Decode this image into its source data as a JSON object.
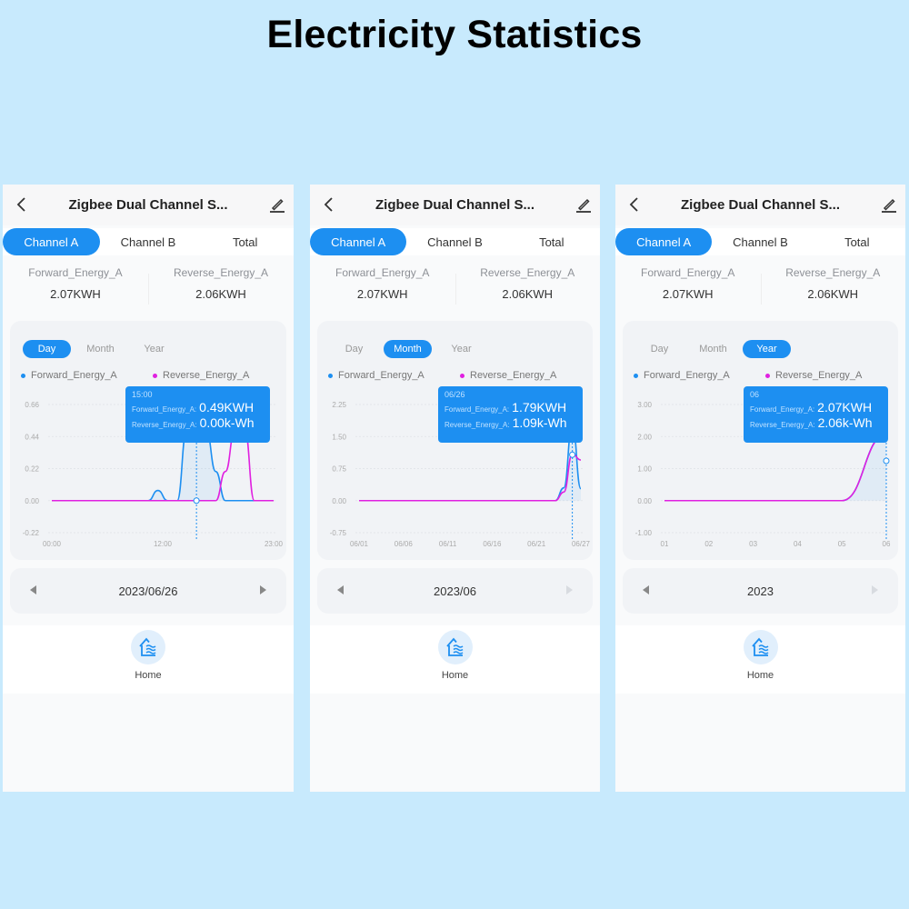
{
  "page_title": "Electricity Statistics",
  "colors": {
    "accent": "#1d8ff1",
    "forward": "#1d8ff1",
    "reverse": "#e020e0",
    "background": "#c8eafd"
  },
  "icons": {
    "back": "chevron-left-icon",
    "edit": "pencil-icon",
    "home": "home-waves-icon",
    "prev": "triangle-left-icon",
    "next": "triangle-right-icon"
  },
  "screens": [
    {
      "device_title": "Zigbee Dual Channel S...",
      "tabs": [
        {
          "label": "Channel A",
          "active": true
        },
        {
          "label": "Channel B",
          "active": false
        },
        {
          "label": "Total",
          "active": false
        }
      ],
      "energy": [
        {
          "label": "Forward_Energy_A",
          "value": "2.07KWH"
        },
        {
          "label": "Reverse_Energy_A",
          "value": "2.06KWH"
        }
      ],
      "ranges": [
        {
          "label": "Day",
          "active": true
        },
        {
          "label": "Month",
          "active": false
        },
        {
          "label": "Year",
          "active": false
        }
      ],
      "legend": [
        "Forward_Energy_A",
        "Reverse_Energy_A"
      ],
      "tooltip": {
        "time": "15:00",
        "forward_key": "Forward_Energy_A:",
        "forward_value": "0.49KWH",
        "reverse_key": "Reverse_Energy_A:",
        "reverse_value": "0.00k-Wh"
      },
      "date": "2023/06/26",
      "next_disabled": false,
      "nav_label": "Home"
    },
    {
      "device_title": "Zigbee Dual Channel S...",
      "tabs": [
        {
          "label": "Channel A",
          "active": true
        },
        {
          "label": "Channel B",
          "active": false
        },
        {
          "label": "Total",
          "active": false
        }
      ],
      "energy": [
        {
          "label": "Forward_Energy_A",
          "value": "2.07KWH"
        },
        {
          "label": "Reverse_Energy_A",
          "value": "2.06KWH"
        }
      ],
      "ranges": [
        {
          "label": "Day",
          "active": false
        },
        {
          "label": "Month",
          "active": true
        },
        {
          "label": "Year",
          "active": false
        }
      ],
      "legend": [
        "Forward_Energy_A",
        "Reverse_Energy_A"
      ],
      "tooltip": {
        "time": "06/26",
        "forward_key": "Forward_Energy_A:",
        "forward_value": "1.79KWH",
        "reverse_key": "Reverse_Energy_A:",
        "reverse_value": "1.09k-Wh"
      },
      "date": "2023/06",
      "next_disabled": true,
      "nav_label": "Home"
    },
    {
      "device_title": "Zigbee Dual Channel S...",
      "tabs": [
        {
          "label": "Channel A",
          "active": true
        },
        {
          "label": "Channel B",
          "active": false
        },
        {
          "label": "Total",
          "active": false
        }
      ],
      "energy": [
        {
          "label": "Forward_Energy_A",
          "value": "2.07KWH"
        },
        {
          "label": "Reverse_Energy_A",
          "value": "2.06KWH"
        }
      ],
      "ranges": [
        {
          "label": "Day",
          "active": false
        },
        {
          "label": "Month",
          "active": false
        },
        {
          "label": "Year",
          "active": true
        }
      ],
      "legend": [
        "Forward_Energy_A",
        "Reverse_Energy_A"
      ],
      "tooltip": {
        "time": "06",
        "forward_key": "Forward_Energy_A:",
        "forward_value": "2.07KWH",
        "reverse_key": "Reverse_Energy_A:",
        "reverse_value": "2.06k-Wh"
      },
      "date": "2023",
      "next_disabled": true,
      "nav_label": "Home"
    }
  ],
  "chart_data": [
    {
      "type": "line",
      "title": "Day",
      "x_tick_labels": [
        "00:00",
        "12:00",
        "23:00"
      ],
      "x_range": [
        0,
        23
      ],
      "y_ticks": [
        -0.22,
        0.0,
        0.22,
        0.44,
        0.66
      ],
      "ylim": [
        -0.22,
        0.66
      ],
      "highlight_x": 15,
      "series": [
        {
          "name": "Forward_Energy_A",
          "x": [
            0,
            10,
            11,
            12,
            13,
            14,
            15,
            16,
            17,
            18,
            19,
            20,
            21,
            22,
            23
          ],
          "values": [
            0,
            0,
            0.07,
            0,
            0,
            0.49,
            0.49,
            0.49,
            0.2,
            0,
            0,
            0,
            0,
            0,
            0
          ]
        },
        {
          "name": "Reverse_Energy_A",
          "x": [
            0,
            10,
            11,
            12,
            13,
            14,
            15,
            16,
            17,
            18,
            19,
            20,
            21,
            22,
            23
          ],
          "values": [
            0,
            0,
            0,
            0,
            0,
            0,
            0,
            0,
            0,
            0.2,
            0.49,
            0.49,
            0,
            0,
            0
          ]
        }
      ]
    },
    {
      "type": "line",
      "title": "Month",
      "x_tick_labels": [
        "06/01",
        "06/06",
        "06/11",
        "06/16",
        "06/21",
        "06/27"
      ],
      "x_range": [
        1,
        27
      ],
      "y_ticks": [
        -0.75,
        0.0,
        0.75,
        1.5,
        2.25
      ],
      "ylim": [
        -0.75,
        2.25
      ],
      "highlight_x": 26,
      "series": [
        {
          "name": "Forward_Energy_A",
          "x": [
            1,
            24,
            25,
            26,
            27
          ],
          "values": [
            0,
            0,
            0.3,
            1.79,
            0.28
          ]
        },
        {
          "name": "Reverse_Energy_A",
          "x": [
            1,
            24,
            25,
            26,
            27
          ],
          "values": [
            0,
            0,
            0.2,
            1.09,
            0.95
          ]
        }
      ]
    },
    {
      "type": "line",
      "title": "Year",
      "x_tick_labels": [
        "01",
        "02",
        "03",
        "04",
        "05",
        "06"
      ],
      "x_range": [
        1,
        6
      ],
      "y_ticks": [
        -1.0,
        0.0,
        1.0,
        2.0,
        3.0
      ],
      "ylim": [
        -1.0,
        3.0
      ],
      "highlight_x": 6,
      "series": [
        {
          "name": "Forward_Energy_A",
          "x": [
            1,
            2,
            3,
            4,
            5,
            6
          ],
          "values": [
            0,
            0,
            0,
            0,
            0,
            2.07
          ]
        },
        {
          "name": "Reverse_Energy_A",
          "x": [
            1,
            2,
            3,
            4,
            5,
            6
          ],
          "values": [
            0,
            0,
            0,
            0,
            0,
            2.06
          ]
        }
      ]
    }
  ]
}
